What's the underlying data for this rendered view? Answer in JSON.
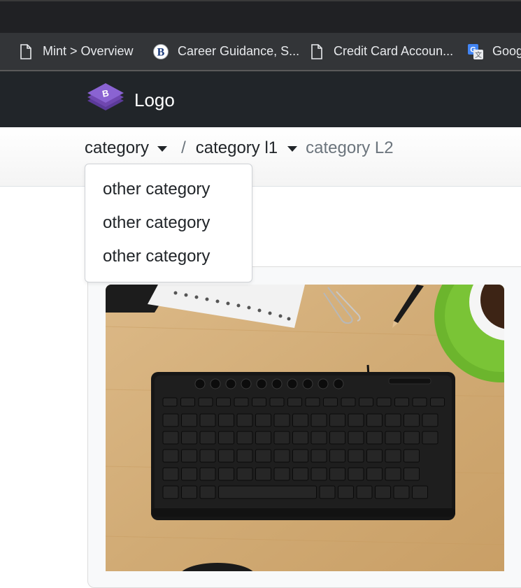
{
  "bookmarks": [
    {
      "label": "Mint > Overview",
      "icon": "page-icon"
    },
    {
      "label": "Career Guidance, S...",
      "icon": "b-logo-icon"
    },
    {
      "label": "Credit Card Accoun...",
      "icon": "page-icon"
    },
    {
      "label": "Goog",
      "icon": "google-translate-icon"
    }
  ],
  "navbar": {
    "brand_text": "Logo",
    "brand_icon": "bootstrap-logo-icon",
    "brand_color": "#7952b3"
  },
  "breadcrumb": {
    "item1": "category",
    "separator": "/",
    "item2": "category l1",
    "item3": "category L2"
  },
  "dropdown": {
    "items": [
      "other category",
      "other category",
      "other category"
    ]
  },
  "card": {
    "image_subject": "keyboard-on-desk-photo"
  }
}
